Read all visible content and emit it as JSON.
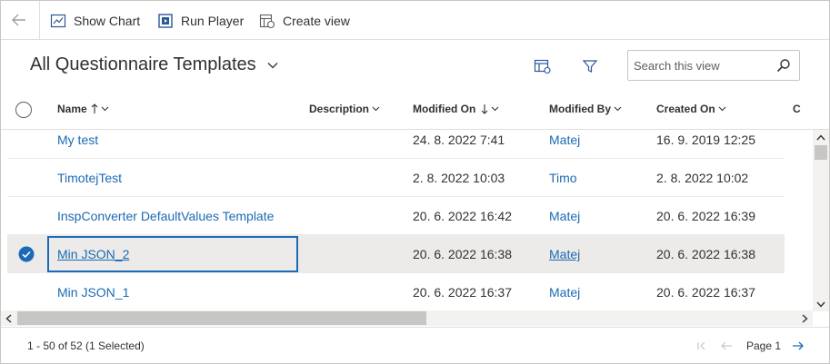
{
  "toolbar": {
    "show_chart": "Show Chart",
    "run_player": "Run Player",
    "create_view": "Create view"
  },
  "view": {
    "title": "All Questionnaire Templates"
  },
  "search": {
    "placeholder": "Search this view"
  },
  "grid": {
    "columns": [
      "Name",
      "Description",
      "Modified On",
      "Modified By",
      "Created On",
      "C"
    ],
    "rows": [
      {
        "name": "My test",
        "description": "",
        "modified_on": "24. 8. 2022 7:41",
        "modified_by": "Matej",
        "created_on": "16. 9. 2019 12:25",
        "selected": false
      },
      {
        "name": "TimotejTest",
        "description": "",
        "modified_on": "2. 8. 2022 10:03",
        "modified_by": "Timo",
        "created_on": "2. 8. 2022 10:02",
        "selected": false
      },
      {
        "name": "InspConverter DefaultValues Template",
        "description": "",
        "modified_on": "20. 6. 2022 16:42",
        "modified_by": "Matej",
        "created_on": "20. 6. 2022 16:39",
        "selected": false
      },
      {
        "name": "Min JSON_2",
        "description": "",
        "modified_on": "20. 6. 2022 16:38",
        "modified_by": "Matej",
        "created_on": "20. 6. 2022 16:38",
        "selected": true
      },
      {
        "name": "Min JSON_1",
        "description": "",
        "modified_on": "20. 6. 2022 16:37",
        "modified_by": "Matej",
        "created_on": "20. 6. 2022 16:37",
        "selected": false
      }
    ]
  },
  "footer": {
    "count": "1 - 50 of 52 (1 Selected)",
    "page": "Page 1"
  },
  "colors": {
    "link": "#1c6ab5",
    "selected_row": "#edebe9",
    "check": "#1c6ab5"
  }
}
